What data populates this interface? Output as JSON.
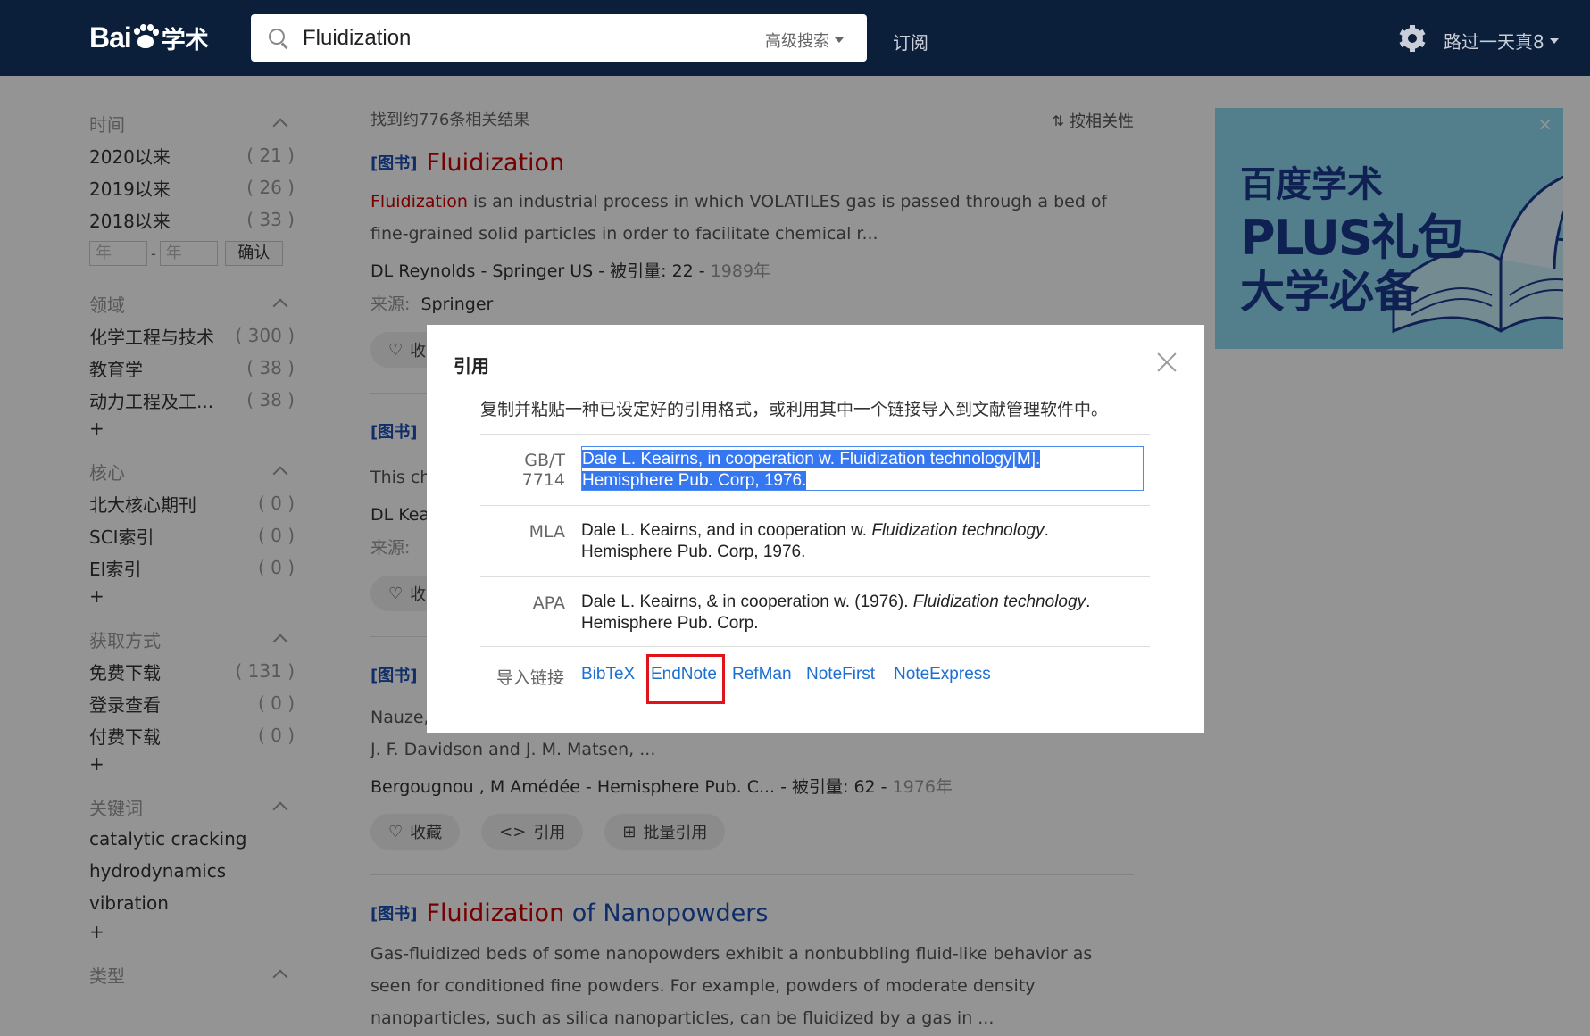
{
  "header": {
    "logo_text": "Bai",
    "logo_text2": "学术",
    "search_value": "Fluidization",
    "advanced_search": "高级搜索",
    "subscribe": "订阅",
    "username": "路过一天真8"
  },
  "sidebar": {
    "time": {
      "title": "时间",
      "items": [
        {
          "label": "2020以来",
          "count": "( 21 )"
        },
        {
          "label": "2019以来",
          "count": "( 26 )"
        },
        {
          "label": "2018以来",
          "count": "( 33 )"
        }
      ],
      "year_placeholder": "年",
      "confirm": "确认"
    },
    "field": {
      "title": "领域",
      "items": [
        {
          "label": "化学工程与技术",
          "count": "( 300 )"
        },
        {
          "label": "教育学",
          "count": "( 38 )"
        },
        {
          "label": "动力工程及工...",
          "count": "( 38 )"
        }
      ]
    },
    "core": {
      "title": "核心",
      "items": [
        {
          "label": "北大核心期刊",
          "count": "( 0 )"
        },
        {
          "label": "SCI索引",
          "count": "( 0 )"
        },
        {
          "label": "EI索引",
          "count": "( 0 )"
        }
      ]
    },
    "access": {
      "title": "获取方式",
      "items": [
        {
          "label": "免费下载",
          "count": "( 131 )"
        },
        {
          "label": "登录查看",
          "count": "( 0 )"
        },
        {
          "label": "付费下载",
          "count": "( 0 )"
        }
      ]
    },
    "keywords": {
      "title": "关键词",
      "items": [
        "catalytic cracking",
        "hydrodynamics",
        "vibration"
      ]
    },
    "type": {
      "title": "类型"
    },
    "plus": "+"
  },
  "results": {
    "count_text": "找到约776条相关结果",
    "sort_label": "按相关性",
    "tag": "[图书]",
    "r1": {
      "title": "Fluidization",
      "abstract_hl": "Fluidization",
      "abstract_rest": " is an industrial process in which VOLATILES gas is passed through a bed of fine-grained solid particles in order to facilitate chemical r...",
      "meta": "DL Reynolds  -  Springer US  -  被引量:  22  - ",
      "year": "1989年",
      "source_label": "来源:",
      "source": "Springer"
    },
    "r2": {
      "abstract_start": "This ch",
      "meta_start": "DL Kea",
      "source_label": "来源:"
    },
    "r3": {
      "abstract_start": "Nauze,",
      "abstract_line2": "J. F. Davidson and J. M. Matsen, ...",
      "meta": "Bergougnou ,   M Amédée  -  Hemisphere Pub. C...  -  被引量:  62  - ",
      "year": "1976年"
    },
    "r4": {
      "title_red": "Fluidization",
      "title_blue": " of Nanopowders",
      "abstract": "Gas-fluidized beds of some nanopowders exhibit a nonbubbling fluid-like behavior as seen for conditioned fine powders. For example, powders of moderate density nanoparticles, such as silica nanoparticles, can be fluidized by a gas in ..."
    },
    "actions": {
      "collect": "收藏",
      "cite": "引用",
      "batch_cite": "批量引用",
      "collect_short": "收"
    }
  },
  "ad": {
    "line1": "百度学术",
    "line2": "PLUS礼包",
    "line3": "大学必备",
    "close": "×"
  },
  "modal": {
    "title": "引用",
    "description": "复制并粘贴一种已设定好的引用格式，或利用其中一个链接导入到文献管理软件中。",
    "gbt_label": "GB/T 7714",
    "gbt_text_l1": "Dale L. Keairns, in cooperation w. Fluidization technology[M].",
    "gbt_text_l2": "Hemisphere Pub. Corp, 1976.",
    "mla_label": "MLA",
    "mla_pre": "Dale L. Keairns, and in cooperation w. ",
    "mla_italic": "Fluidization technology",
    "mla_post": ".",
    "mla_l2": "Hemisphere Pub. Corp, 1976.",
    "apa_label": "APA",
    "apa_pre": "Dale L. Keairns, & in cooperation w. (1976). ",
    "apa_italic": "Fluidization technology",
    "apa_post": ".",
    "apa_l2": "Hemisphere Pub. Corp.",
    "import_label": "导入链接",
    "links": [
      "BibTeX",
      "EndNote",
      "RefMan",
      "NoteFirst",
      "NoteExpress"
    ]
  }
}
